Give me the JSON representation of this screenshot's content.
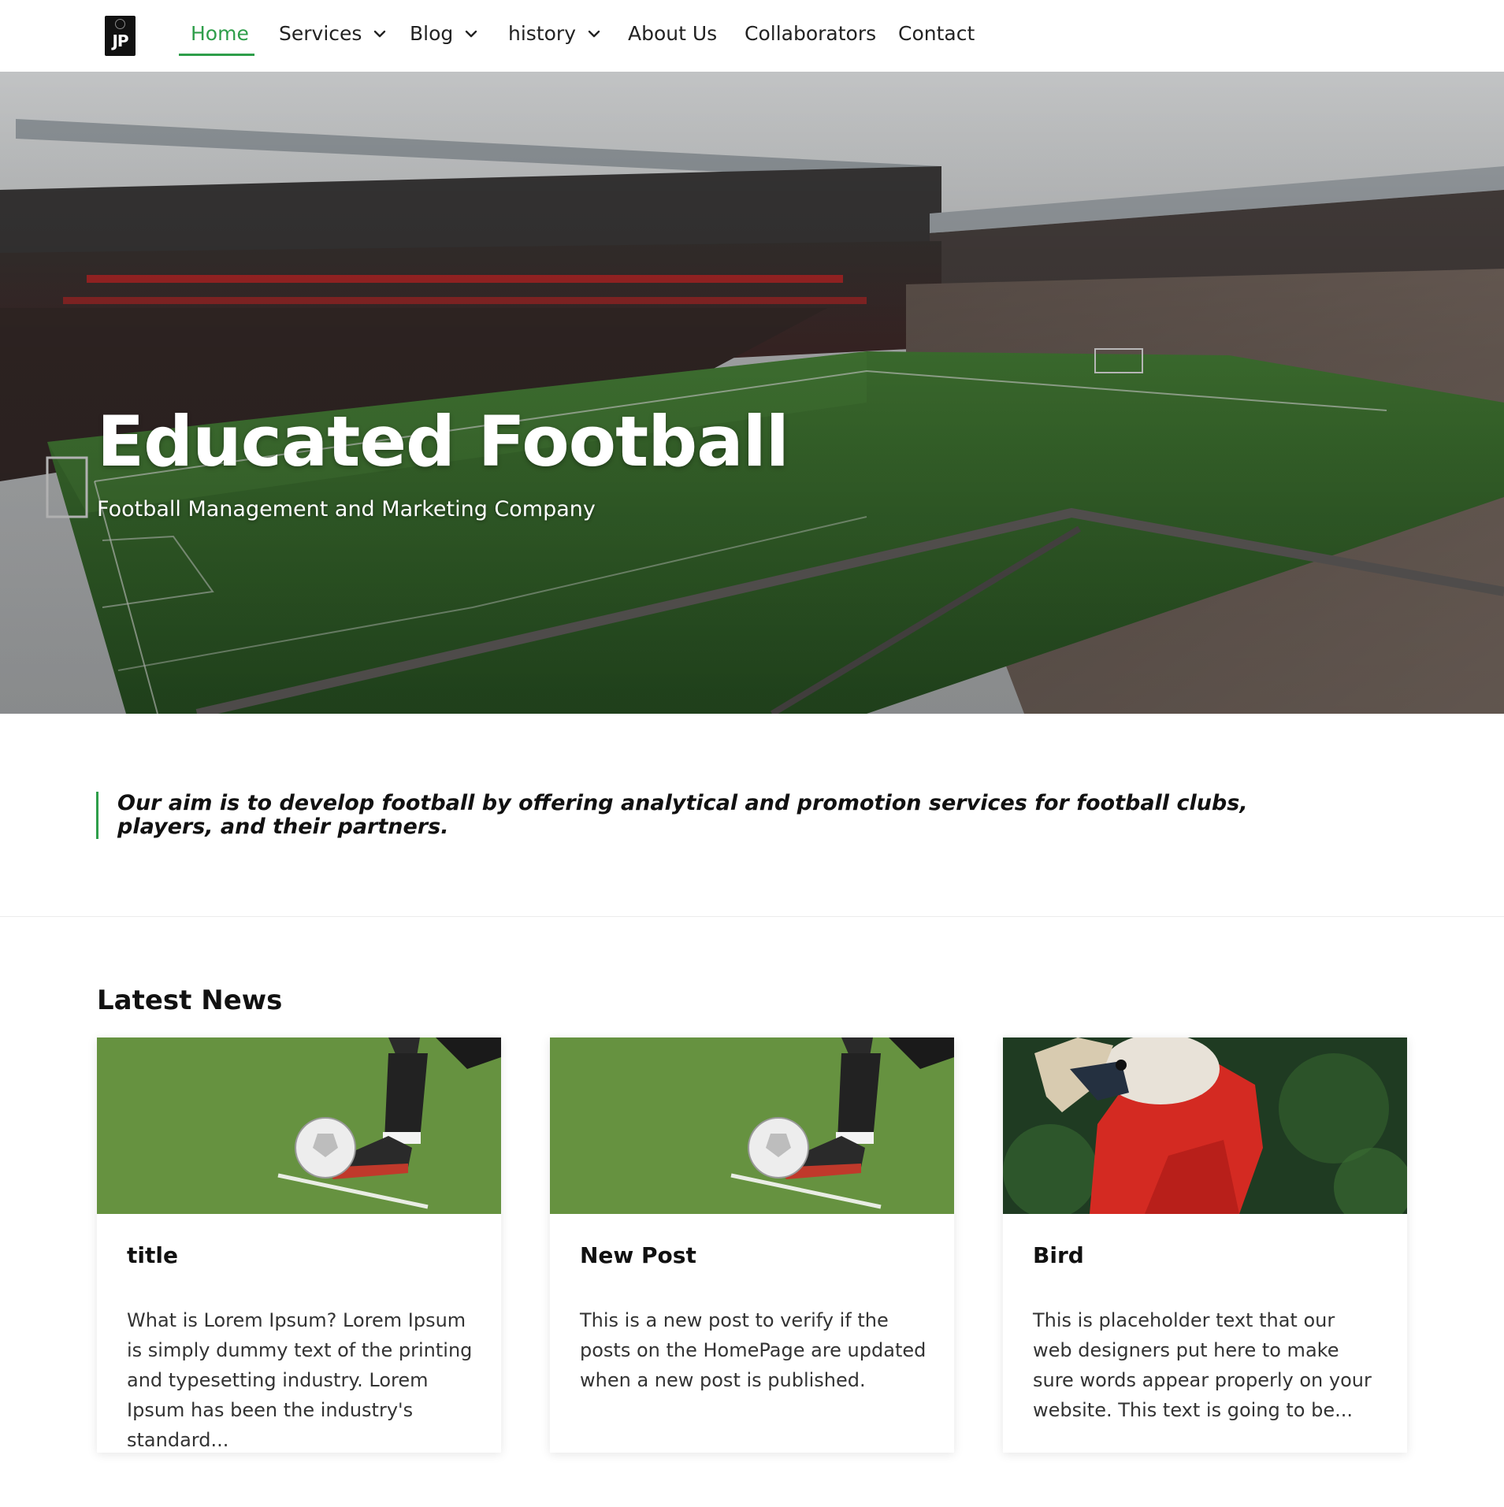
{
  "nav": {
    "logo_text": "JP",
    "items": [
      {
        "label": "Home",
        "active": true
      },
      {
        "label": "Services",
        "dropdown": true
      },
      {
        "label": "Blog",
        "dropdown": true
      },
      {
        "label": "history",
        "dropdown": true
      },
      {
        "label": "About Us"
      },
      {
        "label": "Collaborators"
      },
      {
        "label": "Contact"
      }
    ]
  },
  "hero": {
    "title": "Educated Football",
    "subtitle": "Football Management and Marketing Company"
  },
  "aim": {
    "text": "Our aim is to develop football by offering analytical and promotion services for football clubs, players, and their partners."
  },
  "news": {
    "heading": "Latest News",
    "cards": [
      {
        "title": "title",
        "excerpt": "What is Lorem Ipsum? Lorem Ipsum is simply dummy text of the printing and typesetting industry. Lorem Ipsum has been the industry's standard...",
        "image": "football-kick-photo"
      },
      {
        "title": "New Post",
        "excerpt": "This is a new post to verify if the posts on the HomePage are updated when a new post is published.",
        "image": "football-kick-photo"
      },
      {
        "title": "Bird",
        "excerpt": "This is placeholder text that our web designers put here to make sure words appear properly on your website. This text is going to be...",
        "image": "red-parrot-photo"
      }
    ]
  },
  "colors": {
    "accent": "#2e9e4a",
    "text": "#111111",
    "body_text": "#333333",
    "background": "#ffffff"
  }
}
